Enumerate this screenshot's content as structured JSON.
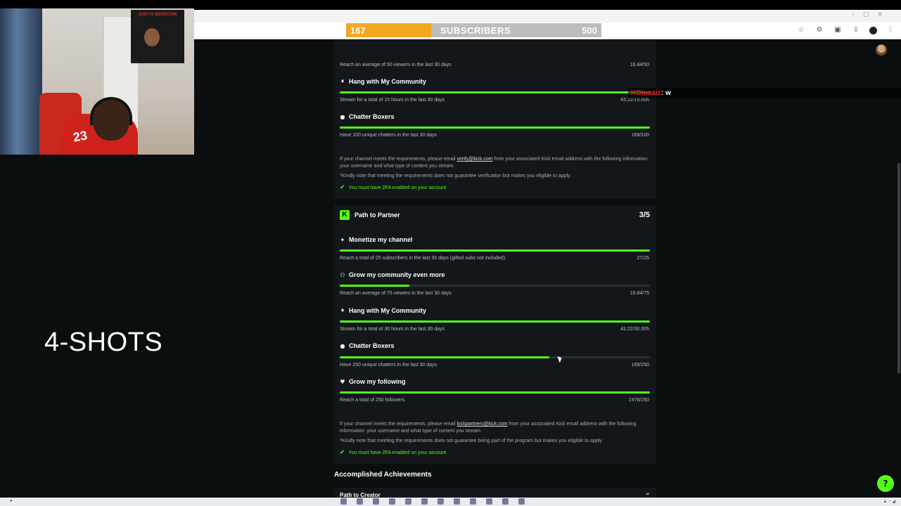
{
  "overlay": {
    "sub_goal": {
      "current": "167",
      "label": "SUBSCRIBERS",
      "max": "500",
      "progress": 0.334
    },
    "shots_label": "4-SHOTS",
    "chat": {
      "user": "KOmaaiz",
      "message": ": w"
    }
  },
  "verification_card": {
    "top_line": {
      "desc": "Reach an average of 50 viewers in the last 30 days",
      "value": "16.84/50"
    },
    "items": [
      {
        "title": "Hang with My Community",
        "icon": "hourglass-icon",
        "progress": 1.0,
        "desc": "Stream for a total of 15 hours in the last 30 days",
        "value": "43.22/15.00h"
      },
      {
        "title": "Chatter Boxers",
        "icon": "chat-bubble-icon",
        "progress": 1.0,
        "desc": "Have 100 unique chatters in the last 30 days",
        "value": "169/100"
      }
    ],
    "note_prefix": "If your channel meets the requirements, please email ",
    "note_link": "verify@kick.com",
    "note_suffix": " from your associated Kick email address with the following information: your username and what type of content you stream.",
    "disclaimer": "*Kindly note that meeting the requirements does not guarantee verification but makes you eligible to apply.",
    "twofa": "You must have 2FA enabled on your account"
  },
  "partner_card": {
    "title": "Path to Partner",
    "count": "3/5",
    "items": [
      {
        "title": "Monetize my channel",
        "icon": "sparkle-icon",
        "progress": 1.0,
        "desc": "Reach a total of 25 subscribers in the last 30 days (gifted subs not included)",
        "value": "27/25"
      },
      {
        "title": "Grow my community even more",
        "icon": "people-icon",
        "progress": 0.225,
        "desc": "Reach an average of 75 viewers in the last 30 days",
        "value": "16.84/75"
      },
      {
        "title": "Hang with My Community",
        "icon": "hourglass-icon",
        "progress": 1.0,
        "desc": "Stream for a total of 30 hours in the last 30 days",
        "value": "43.22/30.00h"
      },
      {
        "title": "Chatter Boxers",
        "icon": "chat-bubble-icon",
        "progress": 0.676,
        "desc": "Have 250 unique chatters in the last 30 days",
        "value": "169/250"
      },
      {
        "title": "Grow my following",
        "icon": "heart-icon",
        "progress": 1.0,
        "desc": "Reach a total of 250 followers",
        "value": "1978/250"
      }
    ],
    "note_prefix": "If your channel meets the requirements, please email ",
    "note_link": "kickpartners@kick.com",
    "note_suffix": " from your associated Kick email address with the following information: your username and what type of content you stream.",
    "disclaimer": "*Kindly note that meeting the requirements does not guarantee being part of the program but makes you eligible to apply.",
    "twofa": "You must have 2FA enabled on your account"
  },
  "achievements": {
    "heading": "Accomplished Achievements",
    "first_item": "Path to Creator"
  },
  "colors": {
    "accent": "#53fc18",
    "background": "#0b0e0f",
    "card": "#13171a",
    "goal_fill": "#f5a623"
  },
  "webcam": {
    "jersey_number": "23",
    "poster_text": "JUICYS BEDROOM"
  }
}
